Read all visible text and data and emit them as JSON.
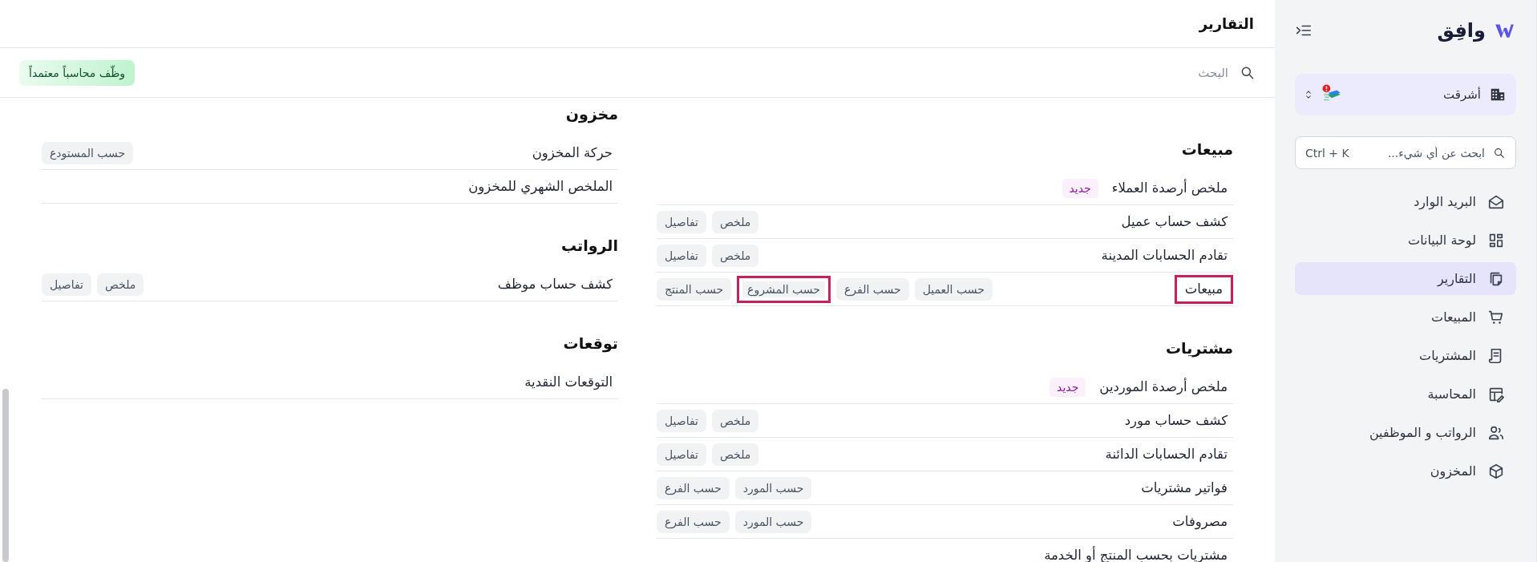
{
  "sidebar": {
    "logo_text": "وافِق",
    "organization": {
      "name": "أشرقت",
      "has_alert": true
    },
    "search": {
      "placeholder": "ابحث عن أي شيء...",
      "shortcut": "Ctrl + K"
    },
    "items": [
      {
        "label": "البريد الوارد",
        "selected": false
      },
      {
        "label": "لوحة البيانات",
        "selected": false
      },
      {
        "label": "التقارير",
        "selected": true
      },
      {
        "label": "المبيعات",
        "selected": false
      },
      {
        "label": "المشتريات",
        "selected": false
      },
      {
        "label": "المحاسبة",
        "selected": false
      },
      {
        "label": "الرواتب و الموظفين",
        "selected": false
      },
      {
        "label": "المخزون",
        "selected": false
      }
    ]
  },
  "header": {
    "title": "التقارير"
  },
  "toolbar": {
    "search": {
      "placeholder": "البحث"
    },
    "promo_button": "وظّف محاسباً معتمداً"
  },
  "columns": [
    [
      {
        "title": "مبيعات",
        "reports": [
          {
            "name": "ملخص أرصدة العملاء",
            "highlighted": false,
            "badge": "جديد"
          },
          {
            "name": "كشف حساب عميل",
            "highlighted": false,
            "tags": [
              {
                "label": "ملخص",
                "highlighted": false
              },
              {
                "label": "تفاصيل",
                "highlighted": false
              }
            ]
          },
          {
            "name": "تقادم الحسابات المدينة",
            "highlighted": false,
            "tags": [
              {
                "label": "ملخص",
                "highlighted": false
              },
              {
                "label": "تفاصيل",
                "highlighted": false
              }
            ]
          },
          {
            "name": "مبيعات",
            "highlighted": true,
            "tags": [
              {
                "label": "حسب العميل",
                "highlighted": false
              },
              {
                "label": "حسب الفرع",
                "highlighted": false
              },
              {
                "label": "حسب المشروع",
                "highlighted": true
              },
              {
                "label": "حسب المنتج",
                "highlighted": false
              }
            ]
          }
        ]
      },
      {
        "title": "مشتريات",
        "reports": [
          {
            "name": "ملخص أرصدة الموردين",
            "highlighted": false,
            "badge": "جديد"
          },
          {
            "name": "كشف حساب مورد",
            "highlighted": false,
            "tags": [
              {
                "label": "ملخص",
                "highlighted": false
              },
              {
                "label": "تفاصيل",
                "highlighted": false
              }
            ]
          },
          {
            "name": "تقادم الحسابات الدائنة",
            "highlighted": false,
            "tags": [
              {
                "label": "ملخص",
                "highlighted": false
              },
              {
                "label": "تفاصيل",
                "highlighted": false
              }
            ]
          },
          {
            "name": "فواتير مشتريات",
            "highlighted": false,
            "tags": [
              {
                "label": "حسب المورد",
                "highlighted": false
              },
              {
                "label": "حسب الفرع",
                "highlighted": false
              }
            ]
          },
          {
            "name": "مصروفات",
            "highlighted": false,
            "tags": [
              {
                "label": "حسب المورد",
                "highlighted": false
              },
              {
                "label": "حسب الفرع",
                "highlighted": false
              }
            ]
          },
          {
            "name": "مشتريات بحسب المنتج أو الخدمة",
            "highlighted": false
          }
        ]
      }
    ],
    [
      {
        "title": "مخزون",
        "reports": [
          {
            "name": "حركة المخزون",
            "highlighted": false,
            "tags": [
              {
                "label": "حسب المستودع",
                "highlighted": false
              }
            ]
          },
          {
            "name": "الملخص الشهري للمخزون",
            "highlighted": false
          }
        ]
      },
      {
        "title": "الرواتب",
        "reports": [
          {
            "name": "كشف حساب موظف",
            "highlighted": false,
            "tags": [
              {
                "label": "ملخص",
                "highlighted": false
              },
              {
                "label": "تفاصيل",
                "highlighted": false
              }
            ]
          }
        ]
      },
      {
        "title": "توقعات",
        "reports": [
          {
            "name": "التوقعات النقدية",
            "highlighted": false
          }
        ]
      }
    ]
  ]
}
